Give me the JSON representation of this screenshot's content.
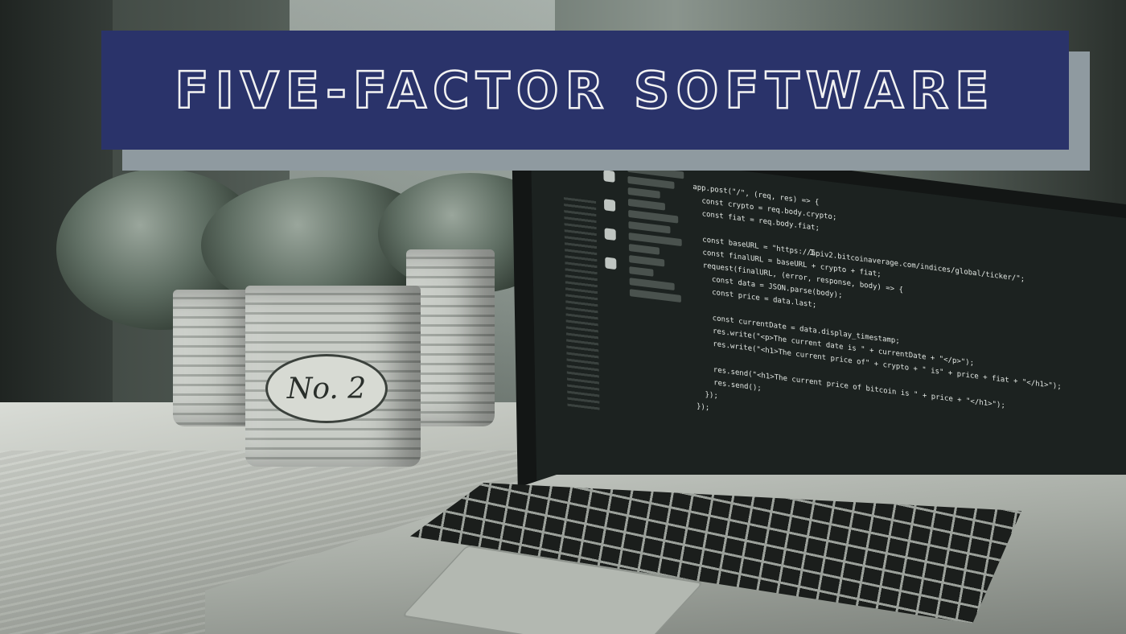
{
  "banner": {
    "title": "FIVE-FACTOR SOFTWARE"
  },
  "pot_label": "No. 2",
  "code_lines": [
    "  app.post(\"/\", (req, res) => {",
    "    const crypto = req.body.crypto;",
    "    const fiat = req.body.fiat;",
    "",
    "    const baseURL = \"https://apiv2.bitcoinaverage.com/indices/global/ticker/\";",
    "    const finalURL = baseURL + crypto + fiat;",
    "    request(finalURL, (error, response, body) => {",
    "      const data = JSON.parse(body);",
    "      const price = data.last;",
    "",
    "      const currentDate = data.display_timestamp;",
    "      res.write(\"<p>The current date is \" + currentDate + \"</p>\");",
    "      res.write(\"<h1>The current price of\" + crypto + \" is\" + price + fiat + \"</h1>\");",
    "",
    "      res.send(\"<h1>The current price of bitcoin is \" + price + \"</h1>\");",
    "      res.send();",
    "    });",
    "  });"
  ],
  "colors": {
    "banner_bg": "#2a336a",
    "banner_shadow": "#8f9aa0",
    "banner_text": "#f2f2f2"
  }
}
